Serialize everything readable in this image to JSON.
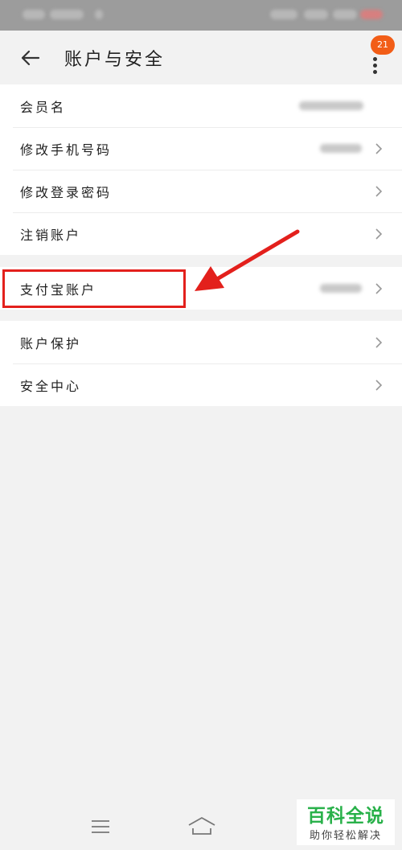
{
  "header": {
    "title": "账户与安全",
    "badge": "21"
  },
  "groups": [
    {
      "items": [
        {
          "label": "会员名"
        },
        {
          "label": "修改手机号码"
        },
        {
          "label": "修改登录密码"
        },
        {
          "label": "注销账户"
        }
      ]
    },
    {
      "items": [
        {
          "label": "支付宝账户"
        }
      ]
    },
    {
      "items": [
        {
          "label": "账户保护"
        },
        {
          "label": "安全中心"
        }
      ]
    }
  ],
  "icons": {
    "back": "arrow-left-icon",
    "more": "more-vertical-icon",
    "chevron": "chevron-right-icon",
    "nav_menu": "menu-icon",
    "nav_home": "home-icon"
  },
  "colors": {
    "accent_badge": "#f25d17",
    "annotation_red": "#e3201c",
    "watermark_green": "#29b14a"
  },
  "watermark": {
    "title": "百科全说",
    "subtitle": "助你轻松解决"
  }
}
